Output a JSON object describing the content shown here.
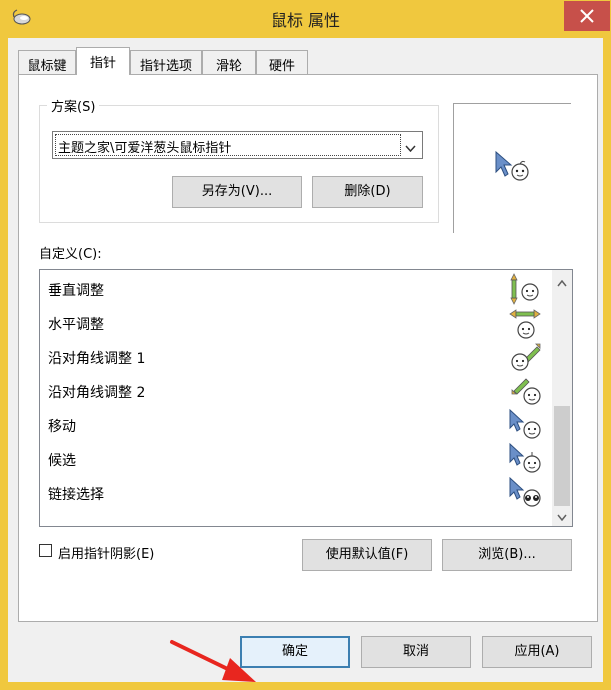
{
  "window": {
    "title": "鼠标 属性",
    "close_icon": "close-icon",
    "titlebar_color": "#f0c83e",
    "close_color": "#c7504a"
  },
  "tabs": [
    {
      "label": "鼠标键",
      "active": false
    },
    {
      "label": "指针",
      "active": true
    },
    {
      "label": "指针选项",
      "active": false
    },
    {
      "label": "滑轮",
      "active": false
    },
    {
      "label": "硬件",
      "active": false
    }
  ],
  "scheme": {
    "legend": "方案(S)",
    "selected": "主题之家\\可爱洋葱头鼠标指针",
    "save_as_label": "另存为(V)...",
    "delete_label": "删除(D)"
  },
  "custom": {
    "label": "自定义(C):",
    "items": [
      {
        "label": "垂直调整",
        "icon": "vertical-resize-cursor-icon"
      },
      {
        "label": "水平调整",
        "icon": "horizontal-resize-cursor-icon"
      },
      {
        "label": "沿对角线调整 1",
        "icon": "diagonal-resize-1-cursor-icon"
      },
      {
        "label": "沿对角线调整 2",
        "icon": "diagonal-resize-2-cursor-icon"
      },
      {
        "label": "移动",
        "icon": "move-cursor-icon"
      },
      {
        "label": "候选",
        "icon": "alternate-select-cursor-icon"
      },
      {
        "label": "链接选择",
        "icon": "link-select-cursor-icon"
      }
    ]
  },
  "options": {
    "shadow_label": "启用指针阴影(E)",
    "shadow_checked": false,
    "use_default_label": "使用默认值(F)",
    "browse_label": "浏览(B)..."
  },
  "footer": {
    "ok_label": "确定",
    "cancel_label": "取消",
    "apply_label": "应用(A)"
  }
}
